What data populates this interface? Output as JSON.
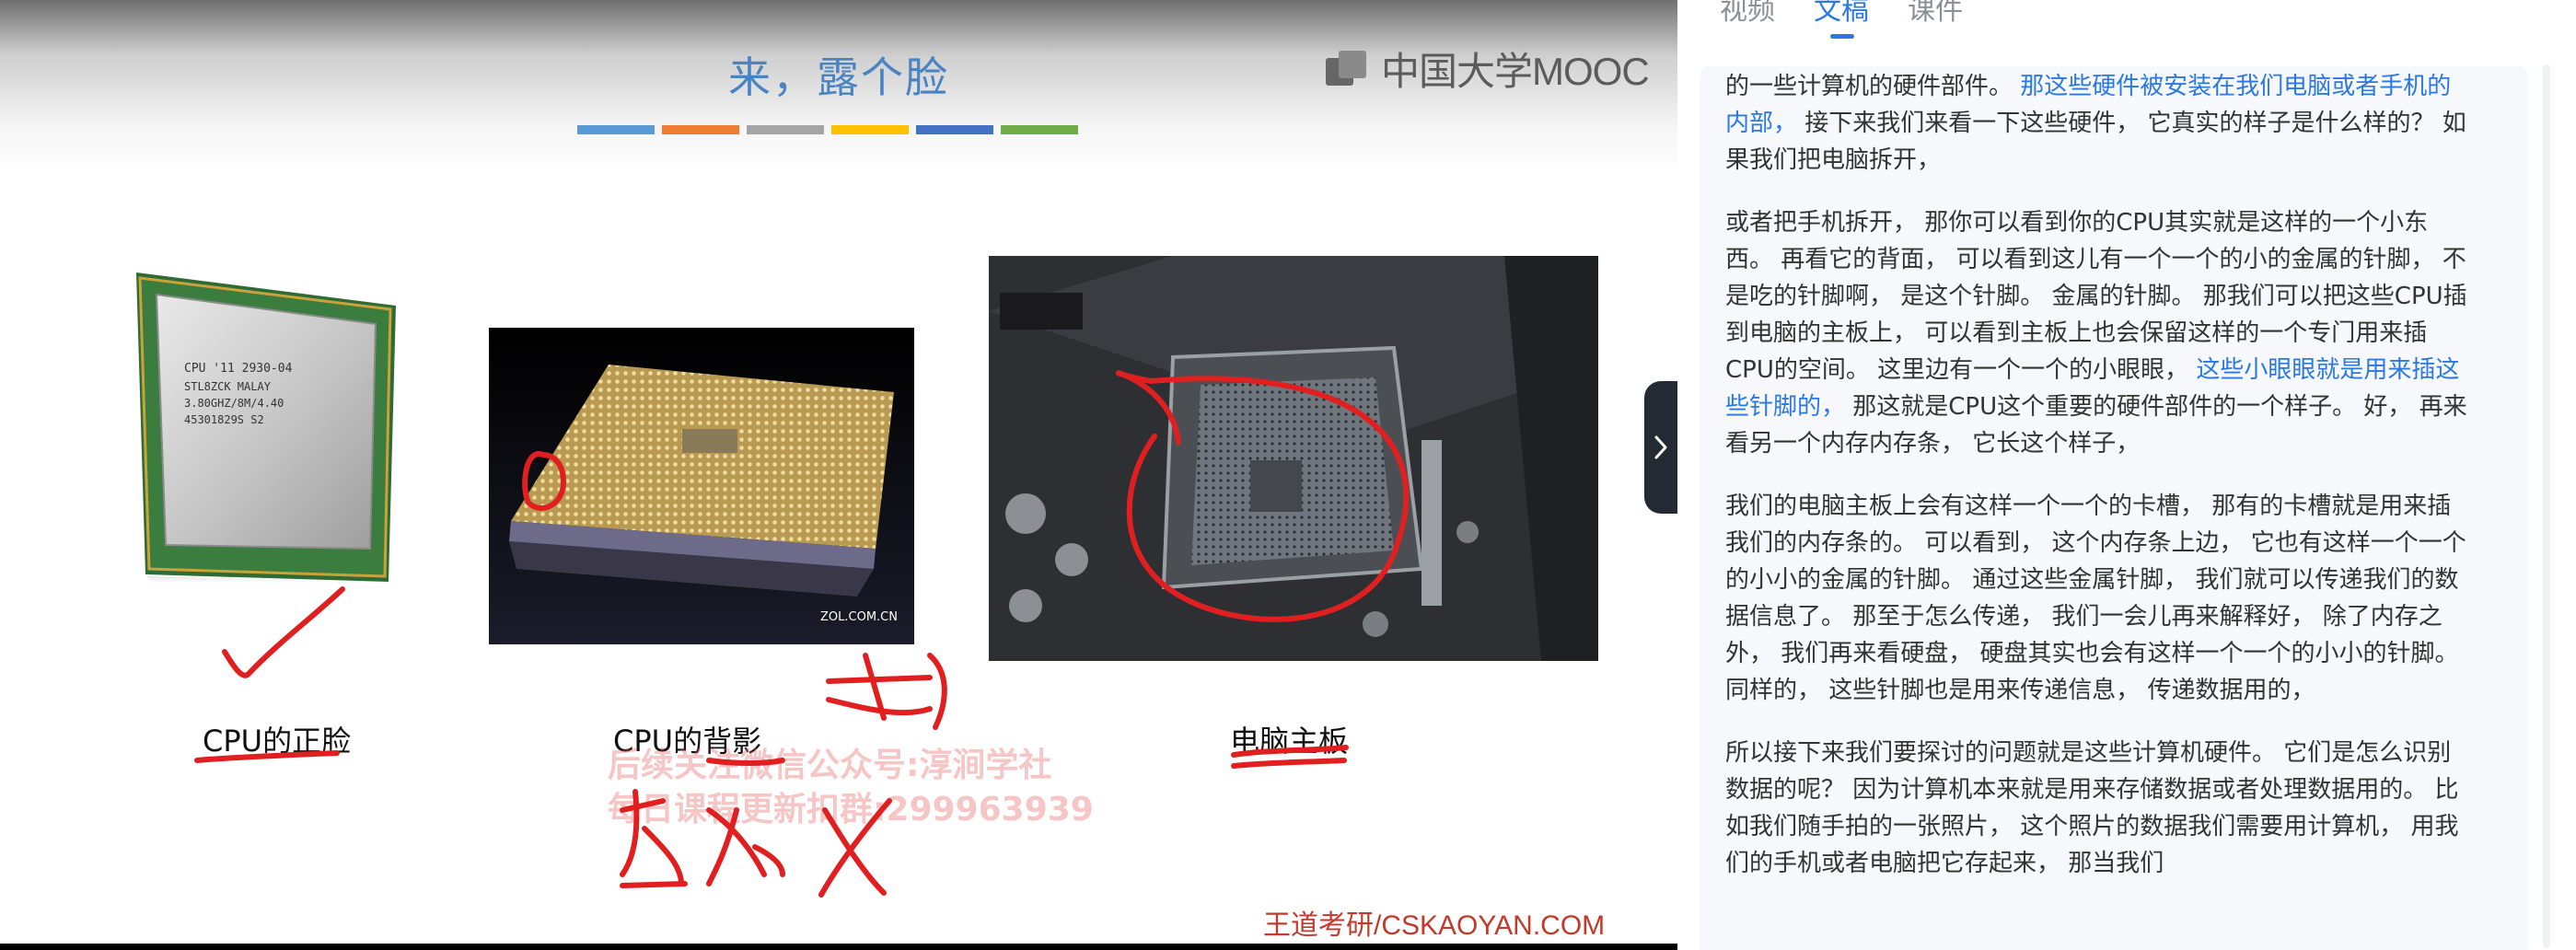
{
  "slide": {
    "title": "来，露个脸",
    "logo_text": "中国大学MOOC",
    "color_bars": [
      "#5b9bd5",
      "#ed7d31",
      "#a5a5a5",
      "#ffc000",
      "#4472c4",
      "#70ad47"
    ],
    "captions": {
      "cpu_front": "CPU的正脸",
      "cpu_back": "CPU的背影",
      "motherboard": "电脑主板"
    },
    "cpu_chip_text": "CPU '11 2930-04\nSTL8ZCK MALAY\n3.80GHZ/8M/4.40\n45301829S S2",
    "cpu_back_logo": "中关村在线\nZOL.COM.CN",
    "watermark_line1": "后续关注微信公众号:淳涧学社",
    "watermark_line2": "每日课程更新扣群:299963939",
    "credit": "王道考研/CSKAOYAN.COM"
  },
  "panel": {
    "tabs": [
      {
        "label": "视频",
        "active": false
      },
      {
        "label": "文稿",
        "active": true
      },
      {
        "label": "课件",
        "active": false
      }
    ],
    "paragraphs": [
      [
        {
          "t": "的一些计算机的硬件部件。 "
        },
        {
          "t": "那这些硬件被安装在我们电脑或者手机的内部，",
          "hl": true
        },
        {
          "t": " 接下来我们来看一下这些硬件， 它真实的样子是什么样的？ 如果我们把电脑拆开，"
        }
      ],
      [
        {
          "t": "或者把手机拆开， 那你可以看到你的CPU其实就是这样的一个小东西。 再看它的背面， 可以看到这儿有一个一个的小的金属的针脚， 不是吃的针脚啊， 是这个针脚。 金属的针脚。 那我们可以把这些CPU插到电脑的主板上， 可以看到主板上也会保留这样的一个专门用来插CPU的空间。 这里边有一个一个的小眼眼， "
        },
        {
          "t": "这些小眼眼就是用来插这些针脚的，",
          "hl": true
        },
        {
          "t": " 那这就是CPU这个重要的硬件部件的一个样子。 好， 再来看另一个内存内存条， 它长这个样子，"
        }
      ],
      [
        {
          "t": "我们的电脑主板上会有这样一个一个的卡槽， 那有的卡槽就是用来插我们的内存条的。 可以看到， 这个内存条上边， 它也有这样一个一个的小小的金属的针脚。 通过这些金属针脚， 我们就可以传递我们的数据信息了。 那至于怎么传递， 我们一会儿再来解释好， 除了内存之外， 我们再来看硬盘， 硬盘其实也会有这样一个一个的小小的针脚。 同样的， 这些针脚也是用来传递信息， 传递数据用的，"
        }
      ],
      [
        {
          "t": "所以接下来我们要探讨的问题就是这些计算机硬件。 它们是怎么识别数据的呢？ 因为计算机本来就是用来存储数据或者处理数据用的。 比如我们随手拍的一张照片， 这个照片的数据我们需要用计算机， 用我们的手机或者电脑把它存起来， 那当我们"
        }
      ]
    ]
  },
  "icons": {
    "collapse": "chevron-right-icon"
  }
}
